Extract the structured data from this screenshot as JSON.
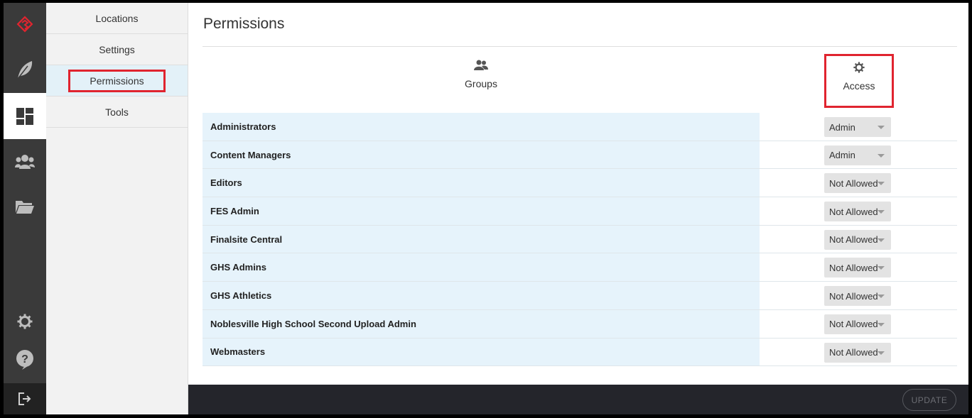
{
  "subnav": {
    "items": [
      {
        "label": "Locations"
      },
      {
        "label": "Settings"
      },
      {
        "label": "Permissions"
      },
      {
        "label": "Tools"
      }
    ]
  },
  "page": {
    "title": "Permissions"
  },
  "columns": {
    "groups": "Groups",
    "access": "Access"
  },
  "rows": [
    {
      "group": "Administrators",
      "access": "Admin"
    },
    {
      "group": "Content Managers",
      "access": "Admin"
    },
    {
      "group": "Editors",
      "access": "Not Allowed"
    },
    {
      "group": "FES Admin",
      "access": "Not Allowed"
    },
    {
      "group": "Finalsite Central",
      "access": "Not Allowed"
    },
    {
      "group": "GHS Admins",
      "access": "Not Allowed"
    },
    {
      "group": "GHS Athletics",
      "access": "Not Allowed"
    },
    {
      "group": "Noblesville High School Second Upload Admin",
      "access": "Not Allowed"
    },
    {
      "group": "Webmasters",
      "access": "Not Allowed"
    }
  ],
  "footer": {
    "update_label": "UPDATE"
  },
  "icons": {
    "rail": [
      "logo-icon",
      "feather-icon",
      "dashboard-icon",
      "users-icon",
      "folder-icon",
      "gear-icon",
      "help-icon",
      "logout-icon"
    ]
  },
  "colors": {
    "accent": "#e0242f",
    "rail": "#3a3a3a",
    "footer": "#24252b",
    "row_highlight": "#e6f3fb"
  }
}
